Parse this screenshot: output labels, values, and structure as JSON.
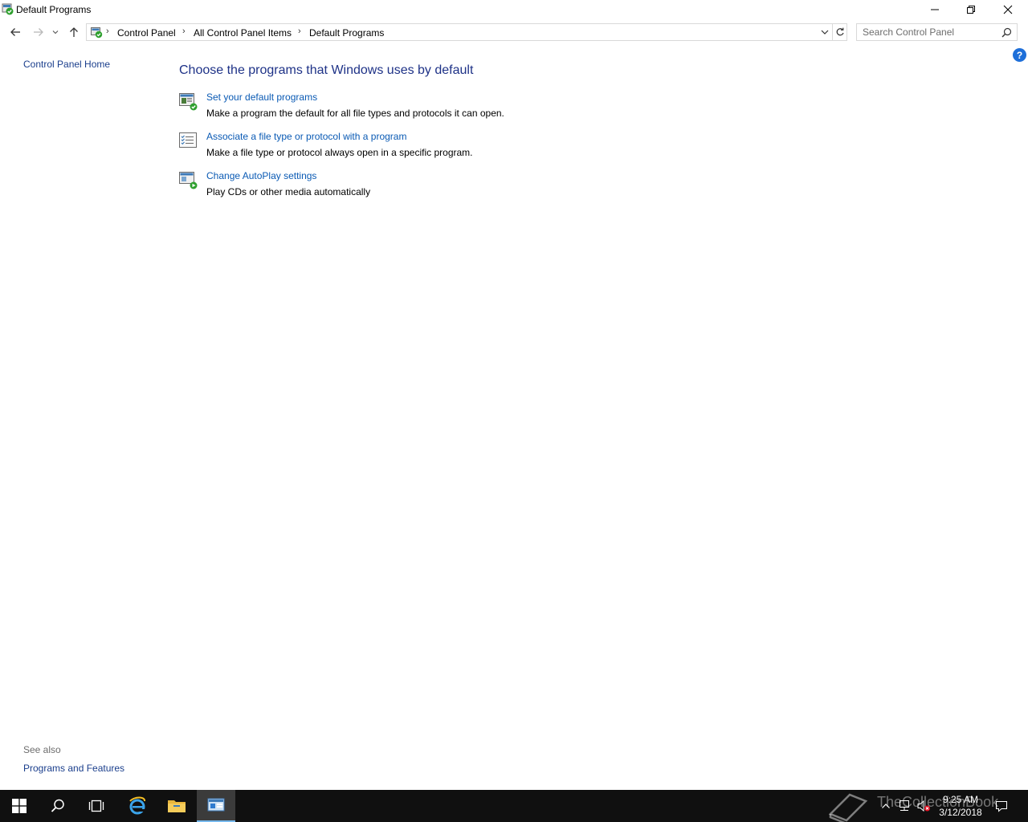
{
  "window": {
    "title": "Default Programs"
  },
  "address": {
    "crumbs": [
      "Control Panel",
      "All Control Panel Items",
      "Default Programs"
    ]
  },
  "search": {
    "placeholder": "Search Control Panel"
  },
  "leftpane": {
    "home_label": "Control Panel Home",
    "see_also": "See also",
    "links": [
      "Programs and Features"
    ]
  },
  "help": {
    "label": "?"
  },
  "main": {
    "title": "Choose the programs that Windows uses by default",
    "tasks": [
      {
        "link": "Set your default programs",
        "desc": "Make a program the default for all file types and protocols it can open.",
        "icon": "default-programs-icon"
      },
      {
        "link": "Associate a file type or protocol with a program",
        "desc": "Make a file type or protocol always open in a specific program.",
        "icon": "file-association-icon"
      },
      {
        "link": "Change AutoPlay settings",
        "desc": "Play CDs or other media automatically",
        "icon": "autoplay-icon"
      }
    ]
  },
  "taskbar": {
    "time": "9:25 AM",
    "date": "3/12/2018",
    "watermark": "TheCollectionBook"
  },
  "colors": {
    "link": "#0a5ab4",
    "title": "#1e3287",
    "taskbar": "#101010",
    "accent": "#76b9ed"
  }
}
